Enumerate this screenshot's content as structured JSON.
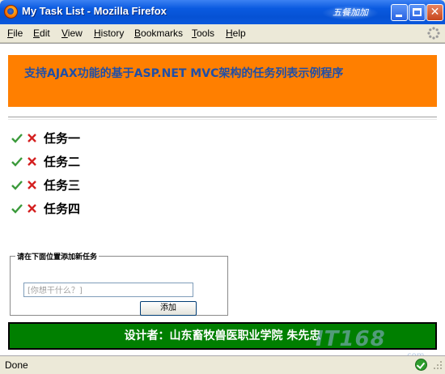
{
  "window": {
    "title": "My Task List - Mozilla Firefox",
    "logo_text": "五餐加加"
  },
  "menu": {
    "items": [
      "File",
      "Edit",
      "View",
      "History",
      "Bookmarks",
      "Tools",
      "Help"
    ]
  },
  "page": {
    "banner_title": "支持AJAX功能的基于ASP.NET MVC架构的任务列表示例程序",
    "tasks": [
      {
        "name": "任务一"
      },
      {
        "name": "任务二"
      },
      {
        "name": "任务三"
      },
      {
        "name": "任务四"
      }
    ],
    "add_form": {
      "legend": "请在下面位置添加新任务",
      "placeholder": "[你想干什么？]",
      "button_label": "添加"
    },
    "footer_text": "设计者：山东畜牧兽医职业学院 朱先忠",
    "watermark": "IT168",
    "watermark_sub": ".com"
  },
  "status": {
    "text": "Done"
  },
  "colors": {
    "banner_bg": "#FF7F00",
    "banner_text": "#1F4FA8",
    "footer_bg": "#007F00",
    "check": "#3B9A3B",
    "delete": "#D42020"
  }
}
